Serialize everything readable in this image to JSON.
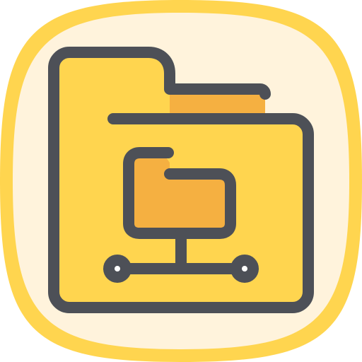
{
  "icon": {
    "name": "network-folder-icon",
    "colors": {
      "background_outer": "#ffd54f",
      "background_inner": "#fff3dc",
      "folder_fill": "#ffd54f",
      "folder_tab_fill": "#f5b041",
      "small_folder_fill": "#f5b041",
      "outline": "#4d5057",
      "node_fill": "#ffffff"
    }
  }
}
